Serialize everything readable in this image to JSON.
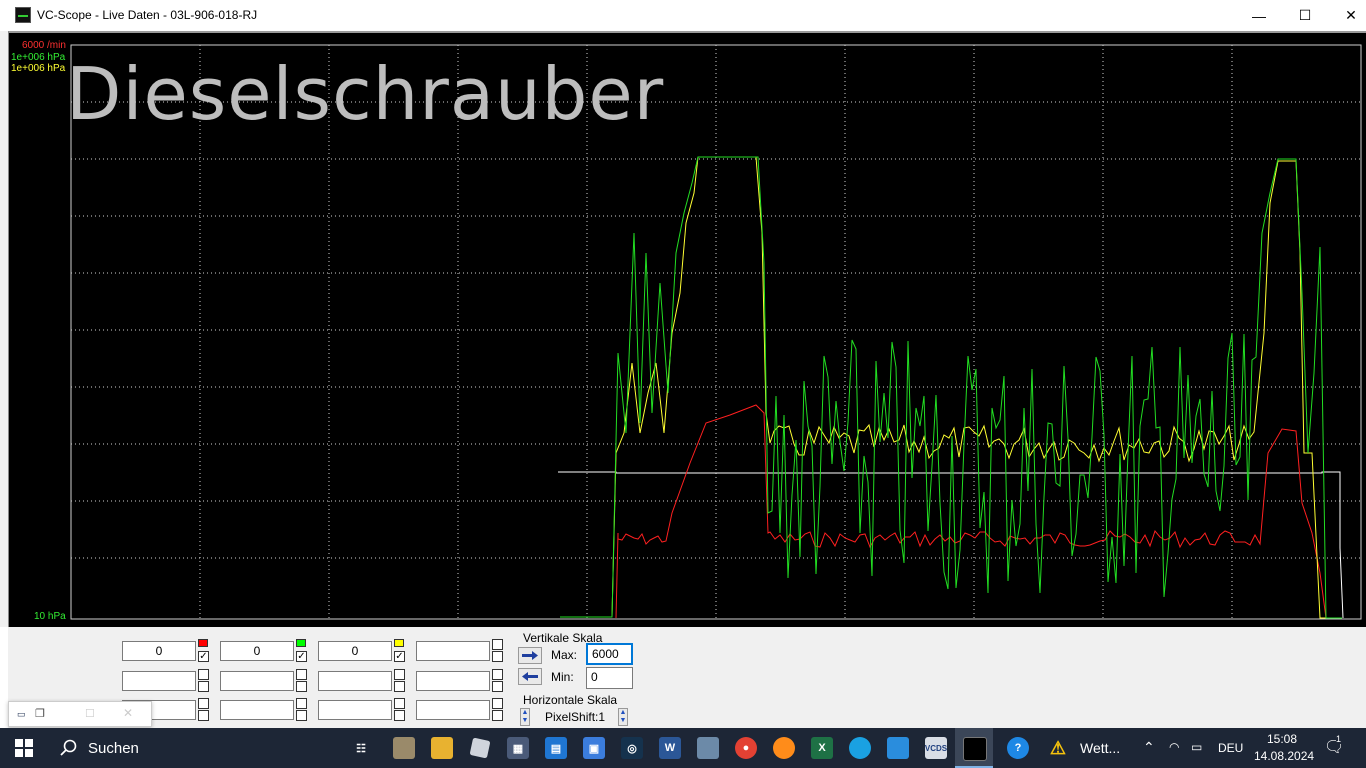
{
  "window": {
    "title": "VC-Scope  -  Live Daten  -  03L-906-018-RJ",
    "minimize": "—",
    "maximize": "☐",
    "close": "✕"
  },
  "scope": {
    "watermark": "Dieselschrauber",
    "scale_top_red": "6000 /min",
    "scale_top_green": "1e+006 hPa",
    "scale_top_yellow": "1e+006 hPa",
    "scale_bottom_green": "10 hPa",
    "colors": {
      "red": "#ff2020",
      "green": "#22dd22",
      "yellow": "#ffff33",
      "grid": "#d0d0d0",
      "white": "#ffffff"
    }
  },
  "channels": {
    "row1": [
      {
        "value": "0",
        "checked": true,
        "color": "#ff0000"
      },
      {
        "value": "0",
        "checked": true,
        "color": "#00ff00"
      },
      {
        "value": "0",
        "checked": true,
        "color": "#ffff00"
      },
      {
        "value": "",
        "checked": false,
        "color": ""
      }
    ],
    "row2": [
      "",
      "",
      "",
      ""
    ],
    "row3": [
      "",
      "",
      "",
      ""
    ]
  },
  "vertical_scale": {
    "label": "Vertikale Skala",
    "max_label": "Max:",
    "max_value": "6000",
    "min_label": "Min:",
    "min_value": "0"
  },
  "horizontal_scale": {
    "label": "Horizontale Skala",
    "pixelshift": "PixelShift:1"
  },
  "taskbar": {
    "search_label": "Suchen",
    "weather": "Wett...",
    "language": "DEU",
    "time": "15:08",
    "date": "14.08.2024",
    "notification_count": "1",
    "icons": [
      "task-view-icon",
      "app-icon",
      "file-explorer-icon",
      "roblox-icon",
      "calculator-icon",
      "calendar-icon",
      "store-icon",
      "steam-icon",
      "word-icon",
      "photos-icon",
      "chrome-icon",
      "firefox-icon",
      "excel-icon",
      "edge-icon",
      "drive-icon",
      "vcds-icon",
      "vc-scope-icon",
      "help-icon",
      "warning-icon"
    ]
  }
}
